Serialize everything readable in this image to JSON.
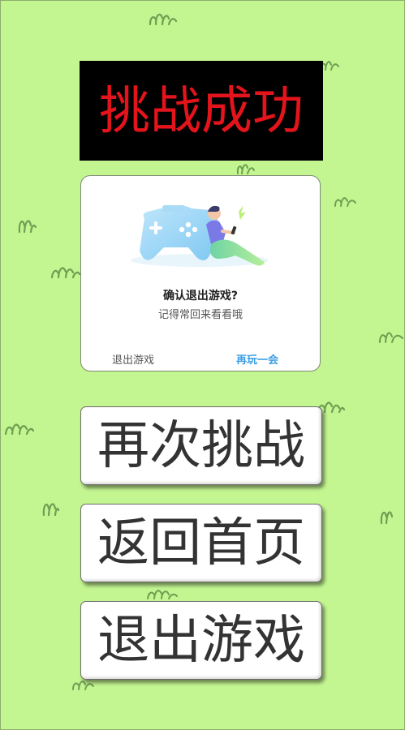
{
  "banner": {
    "title": "挑战成功",
    "title_color": "#e3141b",
    "background": "#000000"
  },
  "dialog": {
    "title": "确认退出游戏?",
    "subtitle": "记得常回来看看哦",
    "exit_label": "退出游戏",
    "replay_label": "再玩一会",
    "accent_color": "#3a9ee6",
    "illustration": "gamepad-with-person-illustration"
  },
  "buttons": {
    "retry_label": "再次挑战",
    "home_label": "返回首页",
    "quit_label": "退出游戏"
  },
  "background": {
    "color": "#c3f591",
    "decoration": "grass-tuft-icon"
  }
}
